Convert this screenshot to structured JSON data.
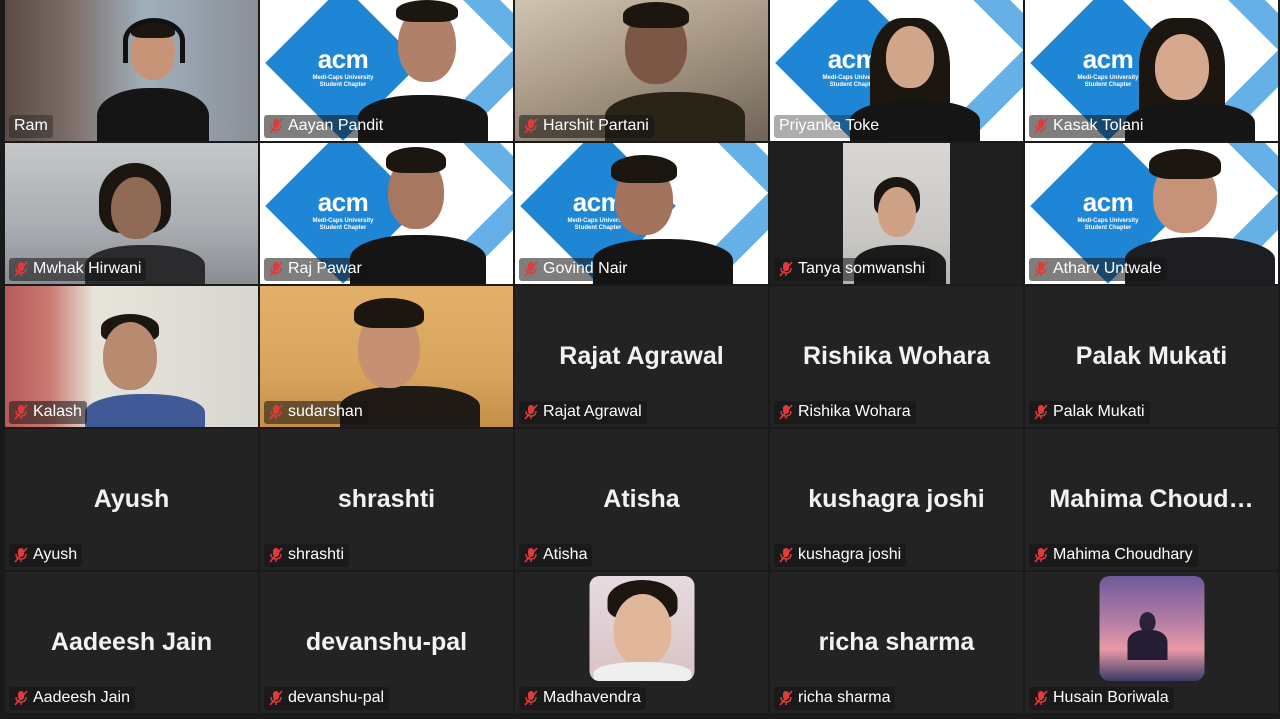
{
  "brand": {
    "acm_logo": "acm",
    "acm_sub1": "Medi-Caps University",
    "acm_sub2": "Student Chapter",
    "accent_blue": "#1f86d6",
    "active_border": "#22c55e",
    "mute_red": "#e03b3b"
  },
  "participants": [
    {
      "name": "Ram",
      "muted": false,
      "view": "camera"
    },
    {
      "name": "Aayan Pandit",
      "muted": true,
      "view": "camera-acm"
    },
    {
      "name": "Harshit Partani",
      "muted": true,
      "view": "camera"
    },
    {
      "name": "Priyanka Toke",
      "muted": false,
      "view": "camera-acm",
      "active_speaker": true
    },
    {
      "name": "Kasak Tolani",
      "muted": true,
      "view": "camera-acm"
    },
    {
      "name": "Mwhak Hirwani",
      "muted": true,
      "view": "camera"
    },
    {
      "name": "Raj Pawar",
      "muted": true,
      "view": "camera-acm"
    },
    {
      "name": "Govind Nair",
      "muted": true,
      "view": "camera-acm"
    },
    {
      "name": "Tanya somwanshi",
      "muted": true,
      "view": "camera"
    },
    {
      "name": "Atharv Untwale",
      "muted": true,
      "view": "camera-acm"
    },
    {
      "name": "Kalash",
      "muted": true,
      "view": "camera"
    },
    {
      "name": "sudarshan",
      "muted": true,
      "view": "camera"
    },
    {
      "name": "Rajat Agrawal",
      "display": "Rajat Agrawal",
      "muted": true,
      "view": "name"
    },
    {
      "name": "Rishika Wohara",
      "display": "Rishika Wohara",
      "muted": true,
      "view": "name"
    },
    {
      "name": "Palak Mukati",
      "display": "Palak Mukati",
      "muted": true,
      "view": "name"
    },
    {
      "name": "Ayush",
      "display": "Ayush",
      "muted": true,
      "view": "name"
    },
    {
      "name": "shrashti",
      "display": "shrashti",
      "muted": true,
      "view": "name"
    },
    {
      "name": "Atisha",
      "display": "Atisha",
      "muted": true,
      "view": "name"
    },
    {
      "name": "kushagra joshi",
      "display": "kushagra joshi",
      "muted": true,
      "view": "name"
    },
    {
      "name": "Mahima Choudhary",
      "display": "Mahima  Choud…",
      "muted": true,
      "view": "name"
    },
    {
      "name": "Aadeesh Jain",
      "display": "Aadeesh Jain",
      "muted": true,
      "view": "name"
    },
    {
      "name": "devanshu-pal",
      "display": "devanshu-pal",
      "muted": true,
      "view": "name"
    },
    {
      "name": "Madhavendra",
      "muted": true,
      "view": "avatar"
    },
    {
      "name": "richa sharma",
      "display": "richa sharma",
      "muted": true,
      "view": "name"
    },
    {
      "name": "Husain Boriwala",
      "muted": true,
      "view": "avatar"
    }
  ]
}
